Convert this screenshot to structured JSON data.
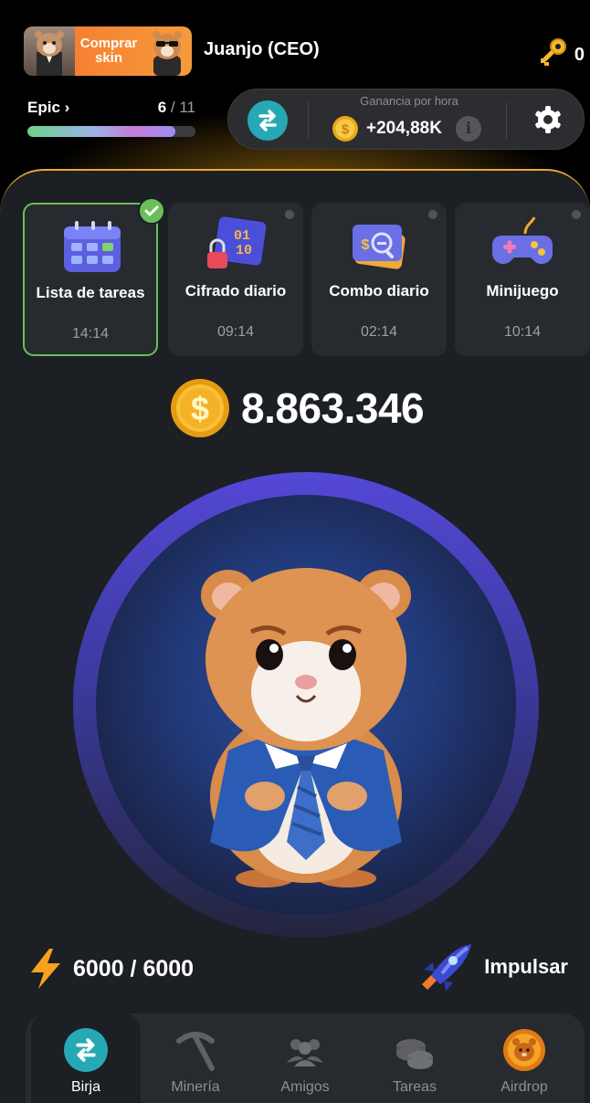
{
  "header": {
    "skin_button_label": "Comprar skin",
    "username": "Juanjo (CEO)",
    "keys_count": "0"
  },
  "rank": {
    "name": "Epic",
    "level_current": "6",
    "level_total": "/ 11",
    "progress_fraction": 0.88
  },
  "profit": {
    "title": "Ganancia por hora",
    "value": "+204,88K",
    "info_label": "i"
  },
  "daily_cards": [
    {
      "title": "Lista de tareas",
      "time": "14:14",
      "completed": true
    },
    {
      "title": "Cifrado diario",
      "time": "09:14",
      "completed": false
    },
    {
      "title": "Combo diario",
      "time": "02:14",
      "completed": false
    },
    {
      "title": "Minijuego",
      "time": "10:14",
      "completed": false
    }
  ],
  "balance": "8.863.346",
  "energy": "6000 / 6000",
  "boost_label": "Impulsar",
  "nav": [
    {
      "label": "Birja",
      "icon": "exchange-icon",
      "active": true
    },
    {
      "label": "Minería",
      "icon": "pickaxe-icon",
      "active": false
    },
    {
      "label": "Amigos",
      "icon": "friends-icon",
      "active": false
    },
    {
      "label": "Tareas",
      "icon": "coins-icon",
      "active": false
    },
    {
      "label": "Airdrop",
      "icon": "hamster-coin-icon",
      "active": false
    }
  ],
  "colors": {
    "accent_gold": "#e8a931",
    "exchange_teal": "#26a8b5",
    "tap_ring": "#5448d6",
    "card_bg": "#272a2f",
    "active_green": "#6bbf5b"
  }
}
